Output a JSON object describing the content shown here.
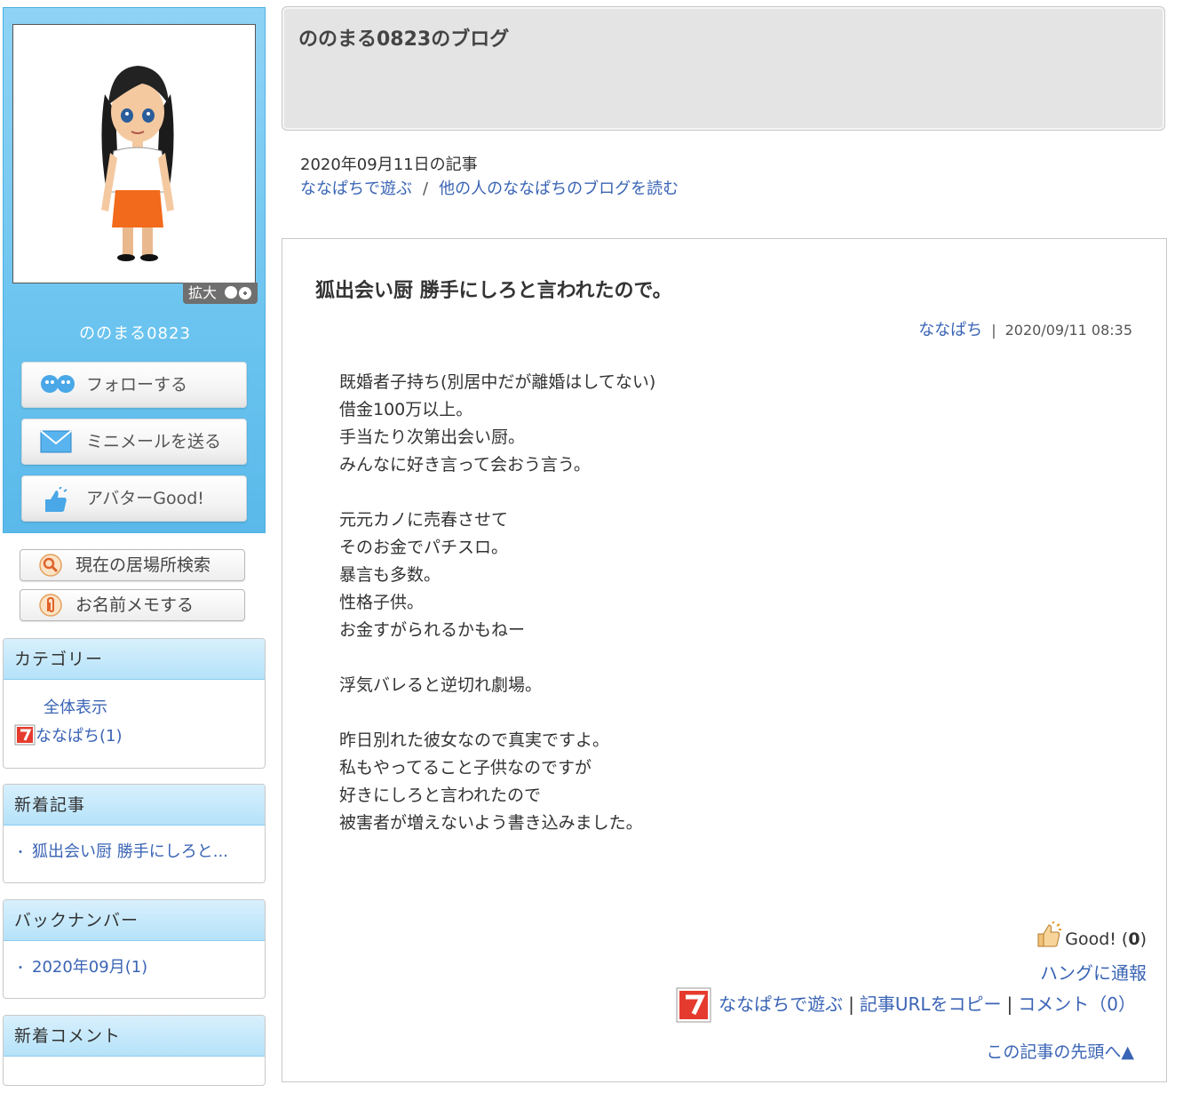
{
  "profile": {
    "zoom_label": "拡大",
    "name": "ののまる0823",
    "follow_label": "フォローする",
    "mail_label": "ミニメールを送る",
    "good_label": "アバターGood!",
    "location_label": "現在の居場所検索",
    "memo_label": "お名前メモする"
  },
  "sidebar": {
    "category": {
      "title": "カテゴリー",
      "items": [
        {
          "label": "全体表示"
        },
        {
          "label": "ななぱち(1)"
        }
      ]
    },
    "recent": {
      "title": "新着記事",
      "items": [
        {
          "label": "狐出会い厨 勝手にしろと..."
        }
      ]
    },
    "backnumber": {
      "title": "バックナンバー",
      "items": [
        {
          "label": "2020年09月(1)"
        }
      ]
    },
    "comments": {
      "title": "新着コメント"
    }
  },
  "blog": {
    "title": "ののまる0823のブログ",
    "date_heading": "2020年09月11日の記事",
    "nav": {
      "play": "ななぱちで遊ぶ",
      "separator": "/",
      "others": "他の人のななぱちのブログを読む"
    }
  },
  "article": {
    "title": "狐出会い厨 勝手にしろと言われたので。",
    "category": "ななぱち",
    "datetime": "2020/09/11 08:35",
    "body": "既婚者子持ち(別居中だが離婚はしてない)\n借金100万以上。\n手当たり次第出会い厨。\nみんなに好き言って会おう言う。\n\n元元カノに売春させて\nそのお金でパチスロ。\n暴言も多数。\n性格子供。\nお金すがられるかもねー\n\n浮気バレると逆切れ劇場。\n\n昨日別れた彼女なので真実ですよ。\n私もやってること子供なのですが\n好きにしろと言われたので\n被害者が増えないよう書き込みました。",
    "good_label": "Good!",
    "good_count": "0",
    "report_label": "ハングに通報",
    "footer": {
      "play": "ななぱちで遊ぶ",
      "copy_url": "記事URLをコピー",
      "comment": "コメント（0）"
    },
    "to_top": "この記事の先頭へ▲"
  },
  "colors": {
    "profile_bg": "#6bc4ef",
    "link": "#3a64b5",
    "section_head": "#b5e2f9",
    "nanapachi_red": "#e53b2e"
  }
}
